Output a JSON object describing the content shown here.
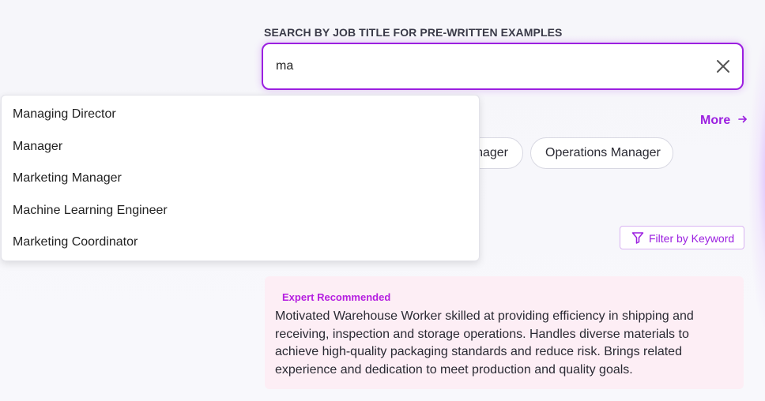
{
  "search": {
    "label": "SEARCH BY JOB TITLE FOR PRE-WRITTEN EXAMPLES",
    "value": "ma",
    "placeholder": ""
  },
  "suggestions": [
    {
      "label": "Managing Director"
    },
    {
      "label": "Manager"
    },
    {
      "label": "Marketing Manager"
    },
    {
      "label": "Machine Learning Engineer"
    },
    {
      "label": "Marketing Coordinator"
    }
  ],
  "related": {
    "more_label": "More",
    "chips": [
      {
        "label": "nager"
      },
      {
        "label": "Operations Manager"
      }
    ]
  },
  "filter": {
    "label": "Filter by Keyword"
  },
  "examples": [
    {
      "badge": "Expert Recommended",
      "text": "Motivated Warehouse Worker skilled at providing efficiency in shipping and receiving, inspection and storage operations. Handles diverse materials to achieve high-quality packaging standards and reduce risk. Brings related experience and dedication to meet production and quality goals."
    }
  ],
  "colors": {
    "accent": "#9b1fe0",
    "badge": "#b51ee0",
    "card_bg": "#fdeef5"
  },
  "icons": {
    "clear": "close-icon",
    "more": "arrow-right-icon",
    "filter": "filter-icon"
  }
}
